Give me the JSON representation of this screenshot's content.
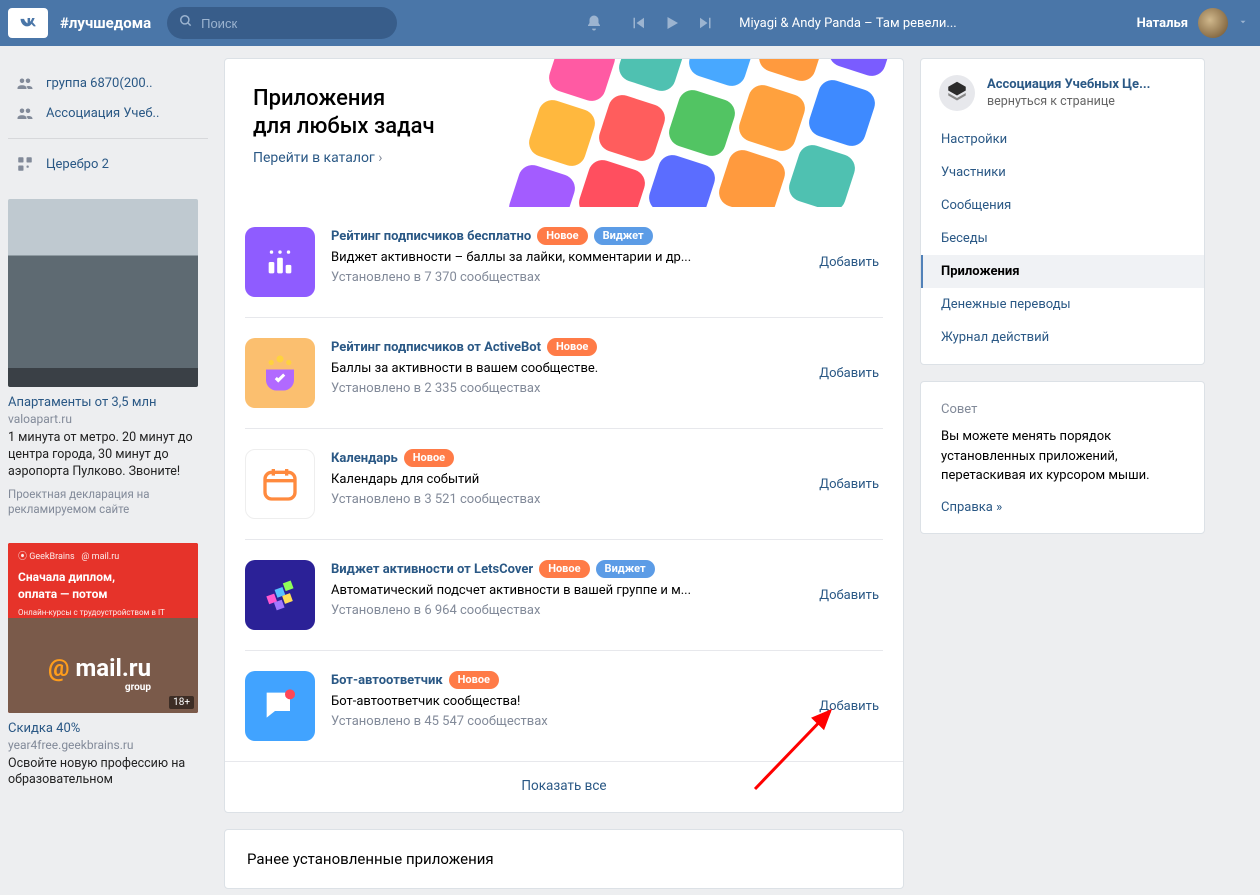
{
  "header": {
    "hashtag": "#лучшедома",
    "search_placeholder": "Поиск",
    "music_title": "Miyagi & Andy Panda – Там ревели...",
    "user_name": "Наталья"
  },
  "left_nav": {
    "items": [
      {
        "label": "группа 6870(200.."
      },
      {
        "label": "Ассоциация Учеб.."
      },
      {
        "label": "Церебро 2"
      }
    ]
  },
  "ads": [
    {
      "title": "Апартаменты от 3,5 млн",
      "domain": "valoapart.ru",
      "text": "1 минута от метро. 20 минут до центра города, 30 минут до аэропорта Пулково. Звоните!",
      "disclaimer": "Проектная декларация на рекламируемом сайте"
    },
    {
      "promo_line1": "Сначала диплом,",
      "promo_line2": "оплата — потом",
      "promo_sub": "Онлайн-курсы с трудоустройством в IT",
      "logo": "mail.ru",
      "logo_sub": "group",
      "age": "18+",
      "title": "Скидка 40%",
      "domain": "year4free.geekbrains.ru",
      "text": "Освойте новую профессию на образовательном"
    }
  ],
  "banner": {
    "line1": "Приложения",
    "line2": "для любых задач",
    "catalog_link": "Перейти в каталог"
  },
  "badges": {
    "new": "Новое",
    "widget": "Виджет"
  },
  "apps": [
    {
      "title": "Рейтинг подписчиков бесплатно",
      "new": true,
      "widget": true,
      "desc": "Виджет активности – баллы за лайки, комментарии и др...",
      "meta": "Установлено в 7 370 сообществах",
      "action": "Добавить",
      "icon": "bars"
    },
    {
      "title": "Рейтинг подписчиков от ActiveBot",
      "new": true,
      "widget": false,
      "desc": "Баллы за активности в вашем сообществе.",
      "meta": "Установлено в 2 335 сообществах",
      "action": "Добавить",
      "icon": "pan"
    },
    {
      "title": "Календарь",
      "new": true,
      "widget": false,
      "desc": "Календарь для событий",
      "meta": "Установлено в 3 521 сообществах",
      "action": "Добавить",
      "icon": "calendar"
    },
    {
      "title": "Виджет активности от LetsCover",
      "new": true,
      "widget": true,
      "desc": "Автоматический подсчет активности в вашей группе и м...",
      "meta": "Установлено в 6 964 сообществах",
      "action": "Добавить",
      "icon": "cubes"
    },
    {
      "title": "Бот-автоответчик",
      "new": true,
      "widget": false,
      "desc": "Бот-автоответчик сообщества!",
      "meta": "Установлено в 45 547 сообществах",
      "action": "Добавить",
      "icon": "chat"
    }
  ],
  "show_all": "Показать все",
  "previously_installed_heading": "Ранее установленные приложения",
  "group_box": {
    "name": "Ассоциация Учебных Це...",
    "back": "вернуться к странице"
  },
  "menu": [
    "Настройки",
    "Участники",
    "Сообщения",
    "Беседы",
    "Приложения",
    "Денежные переводы",
    "Журнал действий"
  ],
  "menu_active_index": 4,
  "tip": {
    "heading": "Совет",
    "text": "Вы можете менять порядок установленных приложений, перетаскивая их курсором мыши.",
    "link": "Справка »"
  }
}
